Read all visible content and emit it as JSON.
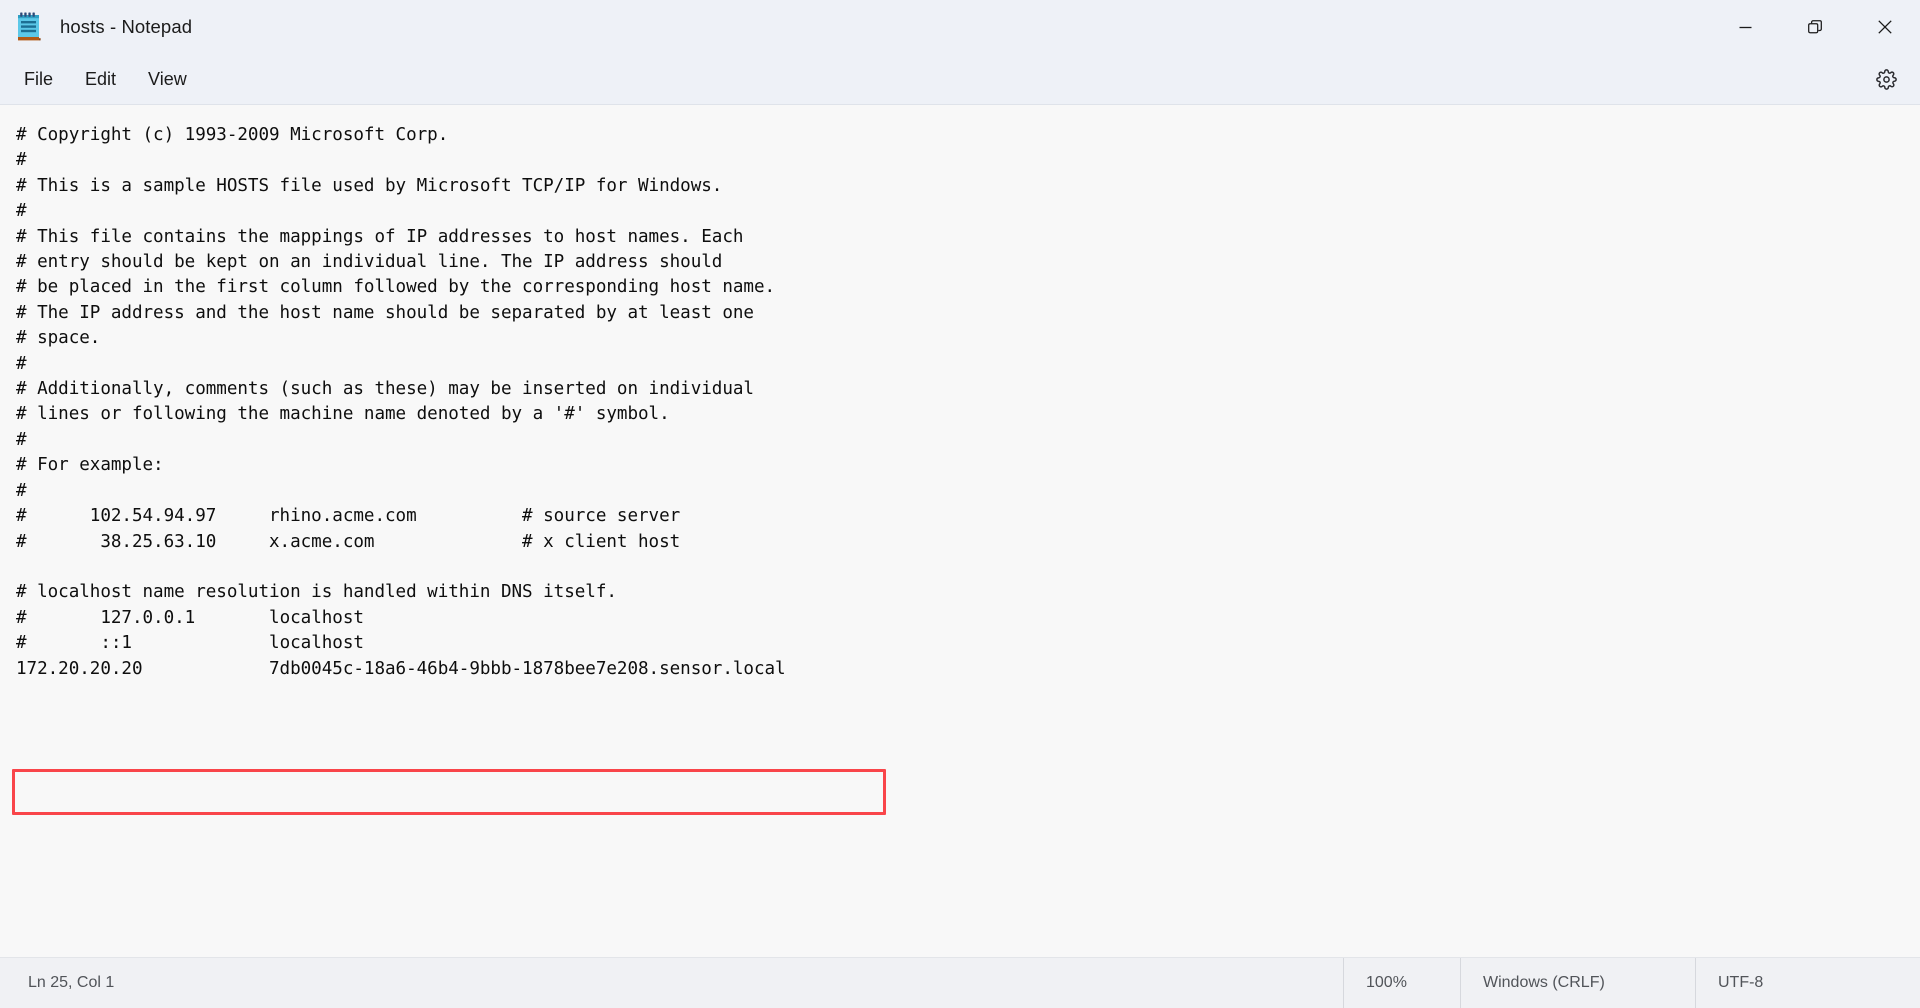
{
  "window": {
    "title": "hosts - Notepad",
    "icon": "notepad-icon",
    "controls": {
      "minimize": "Minimize",
      "restore": "Restore",
      "close": "Close"
    }
  },
  "menubar": {
    "items": [
      {
        "label": "File"
      },
      {
        "label": "Edit"
      },
      {
        "label": "View"
      }
    ],
    "settings": {
      "icon": "gear-icon",
      "label": "Settings"
    }
  },
  "editor": {
    "content": "# Copyright (c) 1993-2009 Microsoft Corp.\n#\n# This is a sample HOSTS file used by Microsoft TCP/IP for Windows.\n#\n# This file contains the mappings of IP addresses to host names. Each\n# entry should be kept on an individual line. The IP address should\n# be placed in the first column followed by the corresponding host name.\n# The IP address and the host name should be separated by at least one\n# space.\n#\n# Additionally, comments (such as these) may be inserted on individual\n# lines or following the machine name denoted by a '#' symbol.\n#\n# For example:\n#\n#      102.54.94.97     rhino.acme.com          # source server\n#       38.25.63.10     x.acme.com              # x client host\n\n# localhost name resolution is handled within DNS itself.\n#\t127.0.0.1       localhost\n#\t::1             localhost\n172.20.20.20            7db0045c-18a6-46b4-9bbb-1878bee7e208.sensor.local\n",
    "highlighted_line": "172.20.20.20            7db0045c-18a6-46b4-9bbb-1878bee7e208.sensor.local",
    "highlight_color": "#f9454a"
  },
  "statusbar": {
    "cursor": "Ln 25, Col 1",
    "zoom": "100%",
    "line_ending": "Windows (CRLF)",
    "encoding": "UTF-8"
  },
  "colors": {
    "chrome": "#eef1f7",
    "editor_bg": "#f8f8f8",
    "status_bg": "#f0f1f4",
    "text": "#0e0e0e",
    "accent_red": "#f9454a"
  }
}
